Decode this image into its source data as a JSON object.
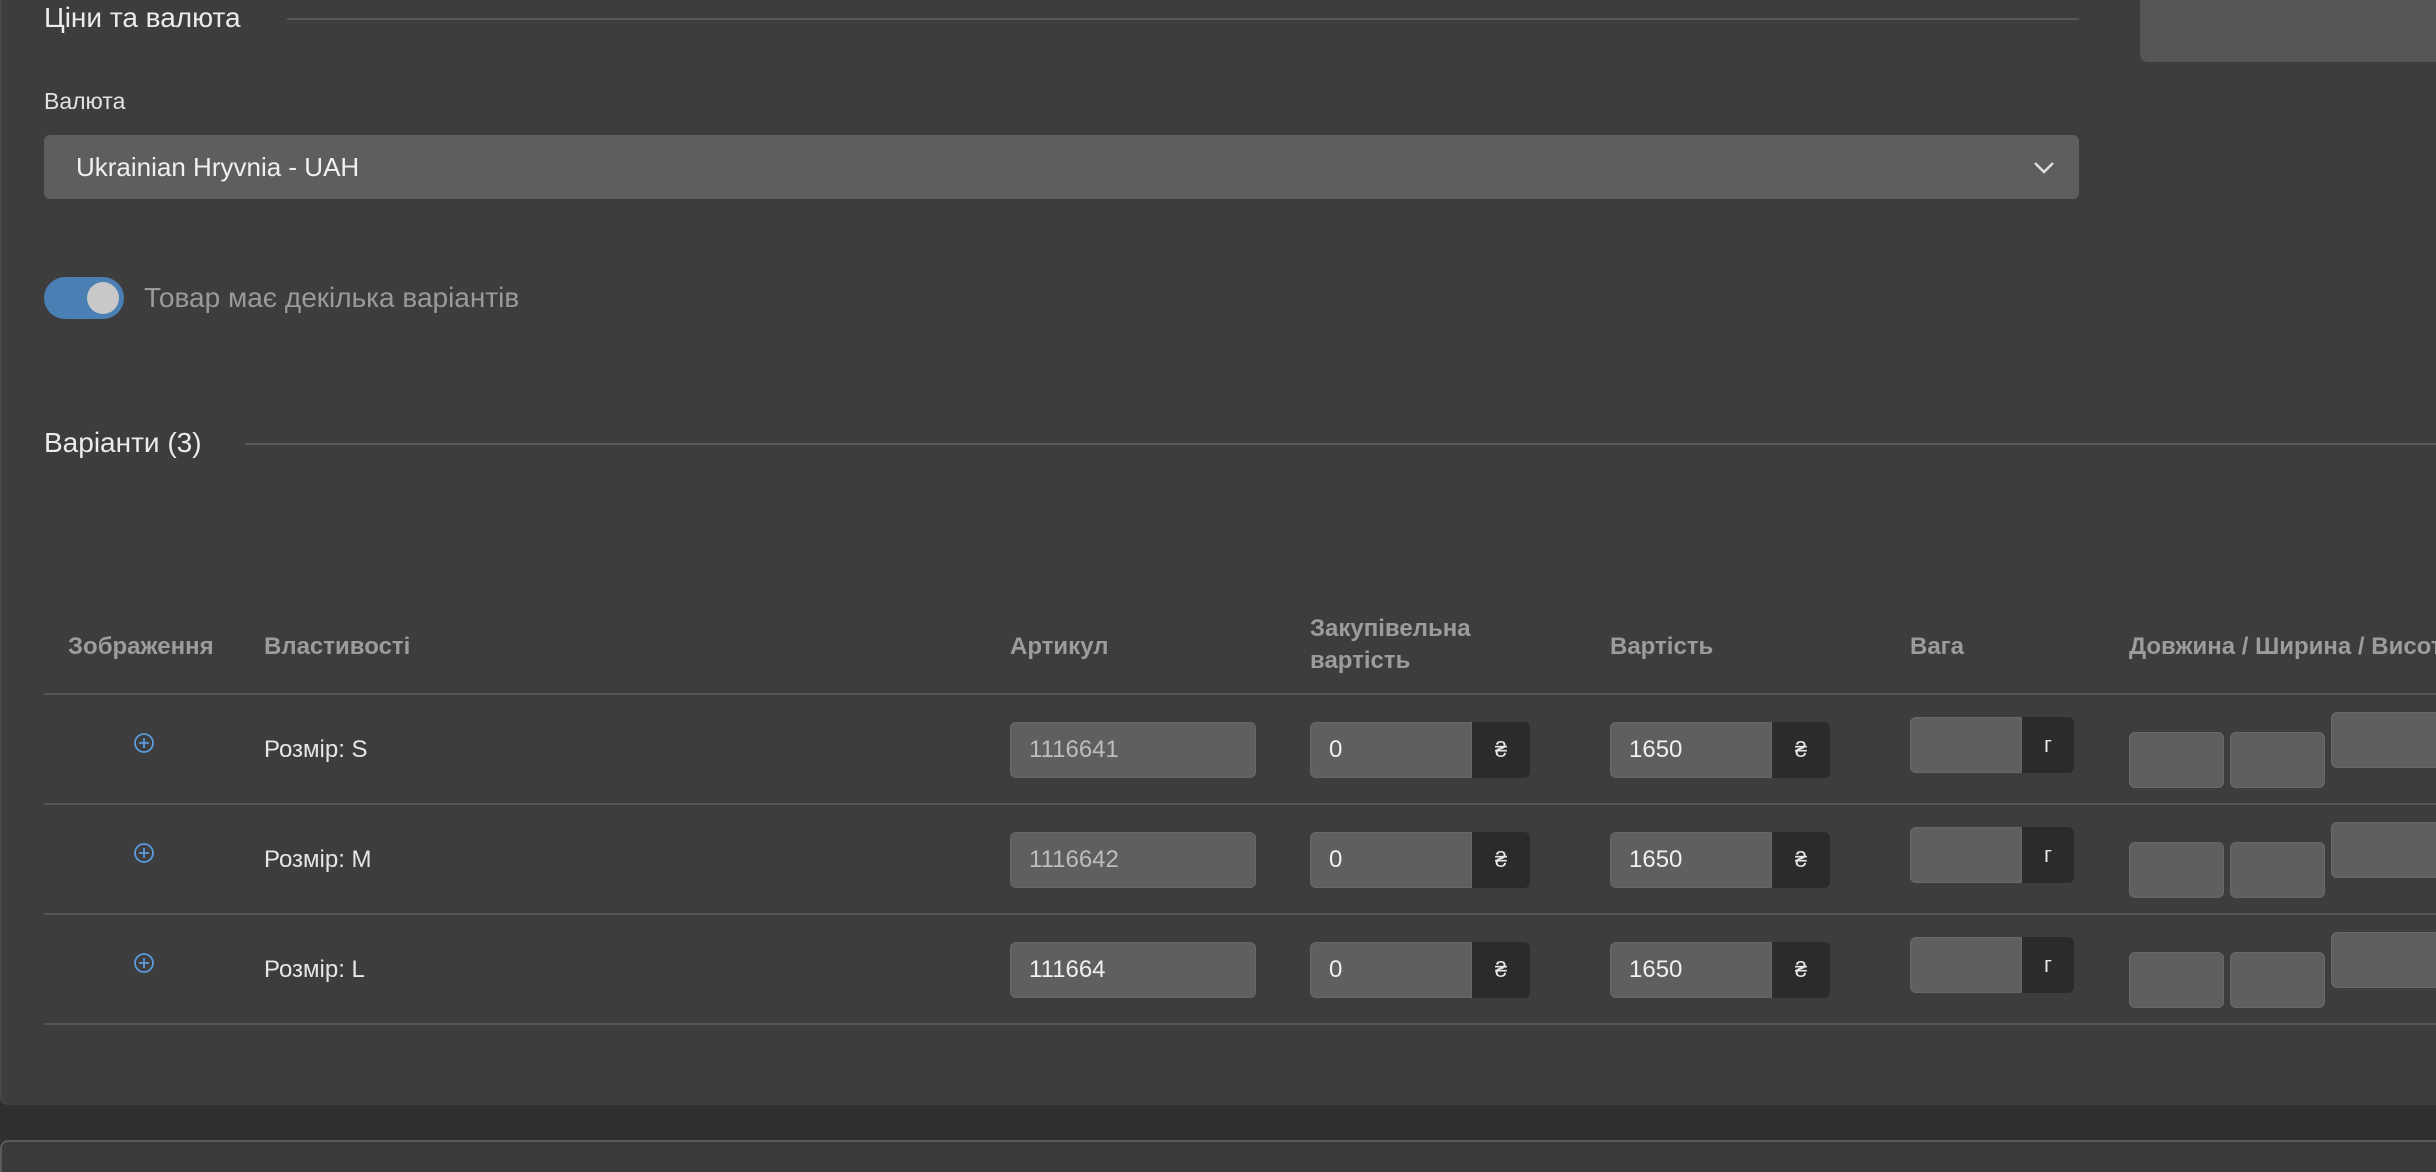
{
  "pricing": {
    "section_title": "Ціни та валюта",
    "currency_label": "Валюта",
    "currency_value": "Ukrainian Hryvnia - UAH",
    "variants_toggle_label": "Товар має декілька варіантів",
    "variants_toggle_on": true
  },
  "variants": {
    "section_title": "Варіанти (3)",
    "columns": {
      "image": "Зображення",
      "properties": "Властивості",
      "sku": "Артикул",
      "purchase_price_line1": "Закупівельна",
      "purchase_price_line2": "вартість",
      "price": "Вартість",
      "weight": "Вага",
      "dimensions": "Довжина / Ширина / Висота"
    },
    "currency_symbol": "₴",
    "weight_unit": "г",
    "rows": [
      {
        "property": "Розмір: S",
        "sku": "1116641",
        "purchase_price": "0",
        "price": "1650"
      },
      {
        "property": "Розмір: M",
        "sku": "1116642",
        "purchase_price": "0",
        "price": "1650"
      },
      {
        "property": "Розмір: L",
        "sku": "111664",
        "purchase_price": "0",
        "price": "1650"
      }
    ]
  },
  "colors": {
    "accent": "#4a7fb4",
    "panel": "#3d3d3d",
    "field": "#5f5f5f"
  }
}
